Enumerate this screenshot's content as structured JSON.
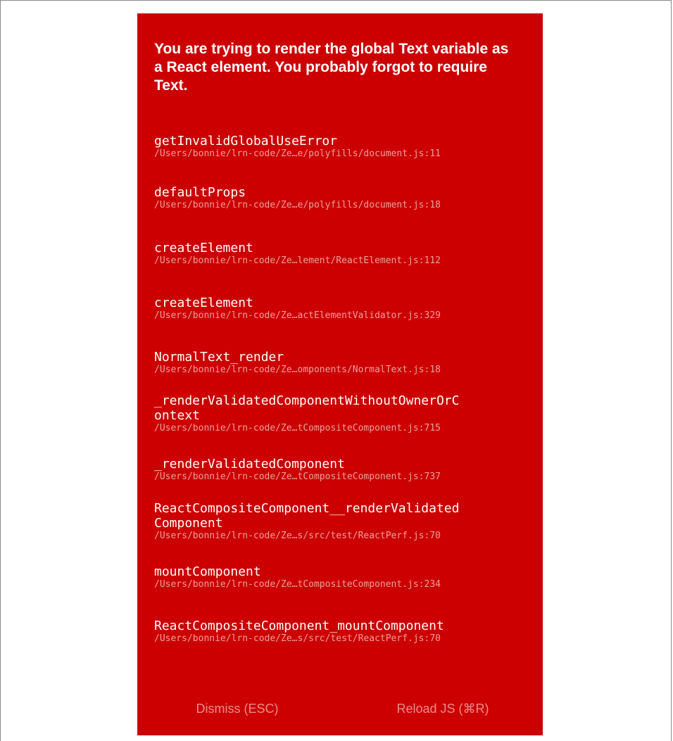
{
  "redbox": {
    "message": "You are trying to render the global Text variable as a React element. You probably forgot to require Text.",
    "stack": [
      {
        "method": "getInvalidGlobalUseError",
        "file": "/Users/bonnie/lrn-code/Ze…e/polyfills/document.js:11"
      },
      {
        "method": "defaultProps",
        "file": "/Users/bonnie/lrn-code/Ze…e/polyfills/document.js:18"
      },
      {
        "method": "createElement",
        "file": "/Users/bonnie/lrn-code/Ze…lement/ReactElement.js:112"
      },
      {
        "method": "createElement",
        "file": "/Users/bonnie/lrn-code/Ze…actElementValidator.js:329"
      },
      {
        "method": "NormalText_render",
        "file": "/Users/bonnie/lrn-code/Ze…omponents/NormalText.js:18"
      },
      {
        "method": "_renderValidatedComponentWithoutOwnerOrC\nontext",
        "file": "/Users/bonnie/lrn-code/Ze…tCompositeComponent.js:715"
      },
      {
        "method": "_renderValidatedComponent",
        "file": "/Users/bonnie/lrn-code/Ze…tCompositeComponent.js:737"
      },
      {
        "method": "ReactCompositeComponent__renderValidated\nComponent",
        "file": "/Users/bonnie/lrn-code/Ze…s/src/test/ReactPerf.js:70"
      },
      {
        "method": "mountComponent",
        "file": "/Users/bonnie/lrn-code/Ze…tCompositeComponent.js:234"
      },
      {
        "method": "ReactCompositeComponent_mountComponent",
        "file": "/Users/bonnie/lrn-code/Ze…s/src/test/ReactPerf.js:70"
      }
    ],
    "dismiss_label": "Dismiss (ESC)",
    "reload_label": "Reload JS (⌘R)"
  },
  "colors": {
    "background": "#cc0000",
    "text": "#ffffff"
  }
}
